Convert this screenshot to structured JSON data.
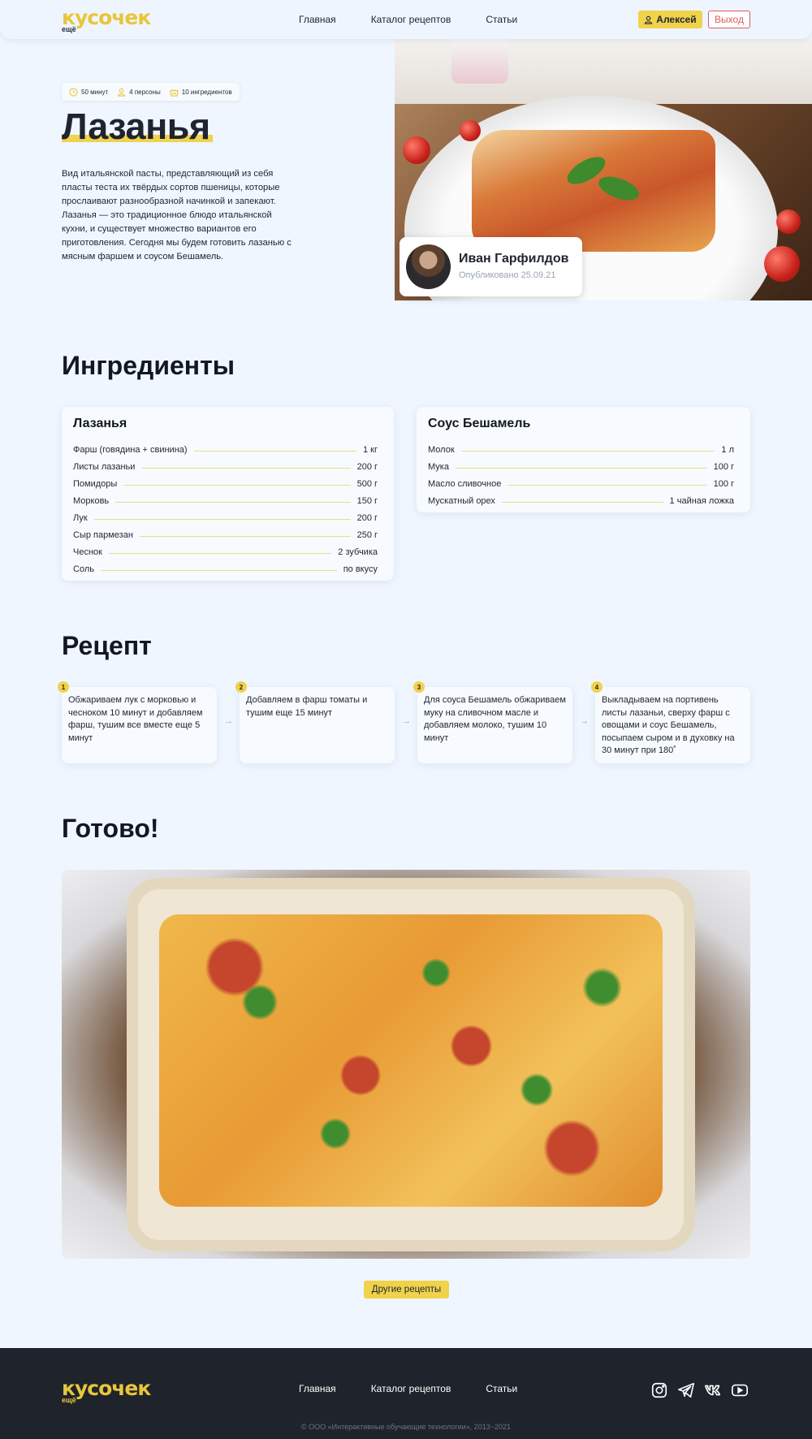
{
  "header": {
    "logo": {
      "main": "кусочек",
      "sub": "ещё"
    },
    "nav": [
      "Главная",
      "Каталог рецептов",
      "Статьи"
    ],
    "user_label": "Алексей",
    "logout_label": "Выход"
  },
  "hero": {
    "chips": [
      {
        "icon": "clock-icon",
        "label": "50 минут"
      },
      {
        "icon": "person-icon",
        "label": "4 персоны"
      },
      {
        "icon": "basket-icon",
        "label": "10 ингредиентов"
      }
    ],
    "title": "Лазанья",
    "intro": "Вид итальянской пасты, представляющий из себя пласты теста их твёрдых сортов пшеницы, которые прослаивают разнообразной начинкой и запекают. Лазанья — это традиционное блюдо итальянской кухни, и существует множество вариантов его приготовления. Сегодня мы будем готовить лазанью с мясным фаршем и соусом Бешамель.",
    "author": {
      "name": "Иван Гарфилдов",
      "published": "Опубликовано 25.09.21"
    }
  },
  "ingredients": {
    "heading": "Ингредиенты",
    "groups": [
      {
        "title": "Лазанья",
        "items": [
          {
            "name": "Фарш (говядина + свинина)",
            "amount": "1 кг"
          },
          {
            "name": "Листы лазаньи",
            "amount": "200 г"
          },
          {
            "name": "Помидоры",
            "amount": "500 г"
          },
          {
            "name": "Морковь",
            "amount": "150 г"
          },
          {
            "name": "Лук",
            "amount": "200 г"
          },
          {
            "name": "Сыр пармезан",
            "amount": "250 г"
          },
          {
            "name": "Чеснок",
            "amount": "2 зубчика"
          },
          {
            "name": "Соль",
            "amount": "по вкусу"
          }
        ]
      },
      {
        "title": "Соус Бешамель",
        "items": [
          {
            "name": "Молок",
            "amount": "1 л"
          },
          {
            "name": "Мука",
            "amount": "100 г"
          },
          {
            "name": "Масло сливочное",
            "amount": "100 г"
          },
          {
            "name": "Мускатный орех",
            "amount": "1 чайная ложка"
          }
        ]
      }
    ]
  },
  "recipe": {
    "heading": "Рецепт",
    "steps": [
      {
        "num": "1",
        "text": "Обжариваем лук с морковью и чесноком 10 минут и добавляем фарш, тушим все вместе еще 5 минут"
      },
      {
        "num": "2",
        "text": "Добавляем в фарш томаты и тушим еще 15 минут"
      },
      {
        "num": "3",
        "text": "Для соуса Бешамель обжариваем муку на сливочном масле и добавляем молоко, тушим 10 минут"
      },
      {
        "num": "4",
        "text": "Выкладываем на портивень листы лазаньи, сверху фарш с овощами и соус Бешамель, посыпаем сыром и в духовку на 30 минут при 180˚"
      }
    ],
    "arrow": "→"
  },
  "ready": {
    "heading": "Готово!",
    "more_label": "Другие рецепты"
  },
  "footer": {
    "logo": {
      "main": "кусочек",
      "sub": "ещё"
    },
    "nav": [
      "Главная",
      "Каталог рецептов",
      "Статьи"
    ],
    "social": [
      "instagram-icon",
      "telegram-icon",
      "vk-icon",
      "youtube-icon"
    ],
    "copyright": "© ООО «Интерактивные обучающие технологии», 2013−2021"
  },
  "colors": {
    "accent": "#f0d24b",
    "logo": "#e8c63a",
    "danger": "#e05a5a",
    "background": "#eff6ff",
    "footer": "#1f232b"
  }
}
